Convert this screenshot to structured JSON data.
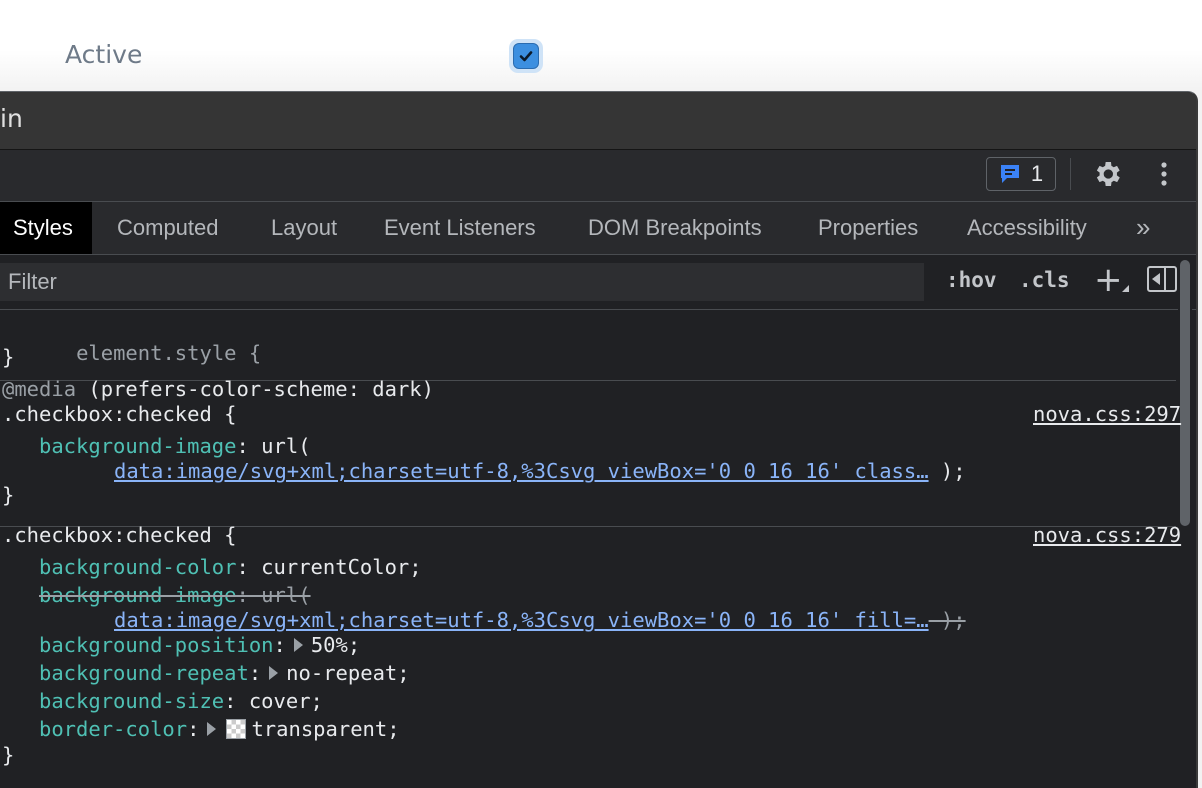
{
  "page": {
    "active_label": "Active",
    "checkbox_checked": true
  },
  "devtools": {
    "title_fragment": "in",
    "issues_count": "1",
    "tabs": [
      "Styles",
      "Computed",
      "Layout",
      "Event Listeners",
      "DOM Breakpoints",
      "Properties",
      "Accessibility"
    ],
    "more_tabs": "»",
    "filter_placeholder": "Filter",
    "hov_label": ":hov",
    "cls_label": ".cls",
    "plus_label": "+",
    "styles": {
      "element_style": "element.style {",
      "close_brace": "}",
      "media_keyword": "@media",
      "media_query": " (prefers-color-scheme: dark)",
      "rule1": {
        "selector": ".checkbox:checked {",
        "source": "nova.css:297",
        "prop": "background-image",
        "val_prefix": ": url(",
        "url": "data:image/svg+xml;charset=utf-8,%3Csvg viewBox='0 0 16 16' class…",
        "val_suffix": " );"
      },
      "rule2": {
        "selector": ".checkbox:checked {",
        "source": "nova.css:279",
        "bg_color_prop": "background-color",
        "bg_color_val": ": currentColor;",
        "bg_image_prop": "background-image",
        "bg_image_val": ": url(",
        "bg_image_url": "data:image/svg+xml;charset=utf-8,%3Csvg viewBox='0 0 16 16' fill=…",
        "bg_image_suffix": " );",
        "bg_pos_prop": "background-position",
        "bg_pos_val": "50%;",
        "bg_repeat_prop": "background-repeat",
        "bg_repeat_val": "no-repeat;",
        "bg_size_prop": "background-size",
        "bg_size_val": ": cover;",
        "border_color_prop": "border-color",
        "border_color_val": "transparent;"
      }
    }
  }
}
